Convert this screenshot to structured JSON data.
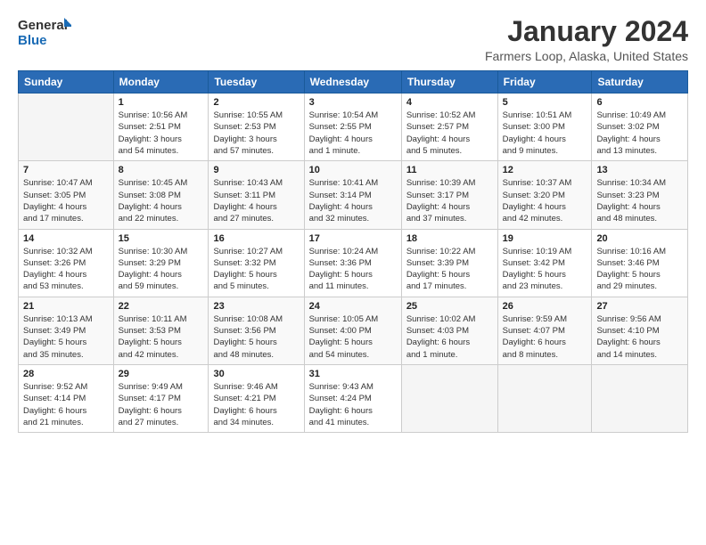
{
  "header": {
    "logo_line1": "General",
    "logo_line2": "Blue",
    "title": "January 2024",
    "subtitle": "Farmers Loop, Alaska, United States"
  },
  "calendar": {
    "days_of_week": [
      "Sunday",
      "Monday",
      "Tuesday",
      "Wednesday",
      "Thursday",
      "Friday",
      "Saturday"
    ],
    "weeks": [
      [
        {
          "num": "",
          "info": ""
        },
        {
          "num": "1",
          "info": "Sunrise: 10:56 AM\nSunset: 2:51 PM\nDaylight: 3 hours\nand 54 minutes."
        },
        {
          "num": "2",
          "info": "Sunrise: 10:55 AM\nSunset: 2:53 PM\nDaylight: 3 hours\nand 57 minutes."
        },
        {
          "num": "3",
          "info": "Sunrise: 10:54 AM\nSunset: 2:55 PM\nDaylight: 4 hours\nand 1 minute."
        },
        {
          "num": "4",
          "info": "Sunrise: 10:52 AM\nSunset: 2:57 PM\nDaylight: 4 hours\nand 5 minutes."
        },
        {
          "num": "5",
          "info": "Sunrise: 10:51 AM\nSunset: 3:00 PM\nDaylight: 4 hours\nand 9 minutes."
        },
        {
          "num": "6",
          "info": "Sunrise: 10:49 AM\nSunset: 3:02 PM\nDaylight: 4 hours\nand 13 minutes."
        }
      ],
      [
        {
          "num": "7",
          "info": "Sunrise: 10:47 AM\nSunset: 3:05 PM\nDaylight: 4 hours\nand 17 minutes."
        },
        {
          "num": "8",
          "info": "Sunrise: 10:45 AM\nSunset: 3:08 PM\nDaylight: 4 hours\nand 22 minutes."
        },
        {
          "num": "9",
          "info": "Sunrise: 10:43 AM\nSunset: 3:11 PM\nDaylight: 4 hours\nand 27 minutes."
        },
        {
          "num": "10",
          "info": "Sunrise: 10:41 AM\nSunset: 3:14 PM\nDaylight: 4 hours\nand 32 minutes."
        },
        {
          "num": "11",
          "info": "Sunrise: 10:39 AM\nSunset: 3:17 PM\nDaylight: 4 hours\nand 37 minutes."
        },
        {
          "num": "12",
          "info": "Sunrise: 10:37 AM\nSunset: 3:20 PM\nDaylight: 4 hours\nand 42 minutes."
        },
        {
          "num": "13",
          "info": "Sunrise: 10:34 AM\nSunset: 3:23 PM\nDaylight: 4 hours\nand 48 minutes."
        }
      ],
      [
        {
          "num": "14",
          "info": "Sunrise: 10:32 AM\nSunset: 3:26 PM\nDaylight: 4 hours\nand 53 minutes."
        },
        {
          "num": "15",
          "info": "Sunrise: 10:30 AM\nSunset: 3:29 PM\nDaylight: 4 hours\nand 59 minutes."
        },
        {
          "num": "16",
          "info": "Sunrise: 10:27 AM\nSunset: 3:32 PM\nDaylight: 5 hours\nand 5 minutes."
        },
        {
          "num": "17",
          "info": "Sunrise: 10:24 AM\nSunset: 3:36 PM\nDaylight: 5 hours\nand 11 minutes."
        },
        {
          "num": "18",
          "info": "Sunrise: 10:22 AM\nSunset: 3:39 PM\nDaylight: 5 hours\nand 17 minutes."
        },
        {
          "num": "19",
          "info": "Sunrise: 10:19 AM\nSunset: 3:42 PM\nDaylight: 5 hours\nand 23 minutes."
        },
        {
          "num": "20",
          "info": "Sunrise: 10:16 AM\nSunset: 3:46 PM\nDaylight: 5 hours\nand 29 minutes."
        }
      ],
      [
        {
          "num": "21",
          "info": "Sunrise: 10:13 AM\nSunset: 3:49 PM\nDaylight: 5 hours\nand 35 minutes."
        },
        {
          "num": "22",
          "info": "Sunrise: 10:11 AM\nSunset: 3:53 PM\nDaylight: 5 hours\nand 42 minutes."
        },
        {
          "num": "23",
          "info": "Sunrise: 10:08 AM\nSunset: 3:56 PM\nDaylight: 5 hours\nand 48 minutes."
        },
        {
          "num": "24",
          "info": "Sunrise: 10:05 AM\nSunset: 4:00 PM\nDaylight: 5 hours\nand 54 minutes."
        },
        {
          "num": "25",
          "info": "Sunrise: 10:02 AM\nSunset: 4:03 PM\nDaylight: 6 hours\nand 1 minute."
        },
        {
          "num": "26",
          "info": "Sunrise: 9:59 AM\nSunset: 4:07 PM\nDaylight: 6 hours\nand 8 minutes."
        },
        {
          "num": "27",
          "info": "Sunrise: 9:56 AM\nSunset: 4:10 PM\nDaylight: 6 hours\nand 14 minutes."
        }
      ],
      [
        {
          "num": "28",
          "info": "Sunrise: 9:52 AM\nSunset: 4:14 PM\nDaylight: 6 hours\nand 21 minutes."
        },
        {
          "num": "29",
          "info": "Sunrise: 9:49 AM\nSunset: 4:17 PM\nDaylight: 6 hours\nand 27 minutes."
        },
        {
          "num": "30",
          "info": "Sunrise: 9:46 AM\nSunset: 4:21 PM\nDaylight: 6 hours\nand 34 minutes."
        },
        {
          "num": "31",
          "info": "Sunrise: 9:43 AM\nSunset: 4:24 PM\nDaylight: 6 hours\nand 41 minutes."
        },
        {
          "num": "",
          "info": ""
        },
        {
          "num": "",
          "info": ""
        },
        {
          "num": "",
          "info": ""
        }
      ]
    ]
  }
}
